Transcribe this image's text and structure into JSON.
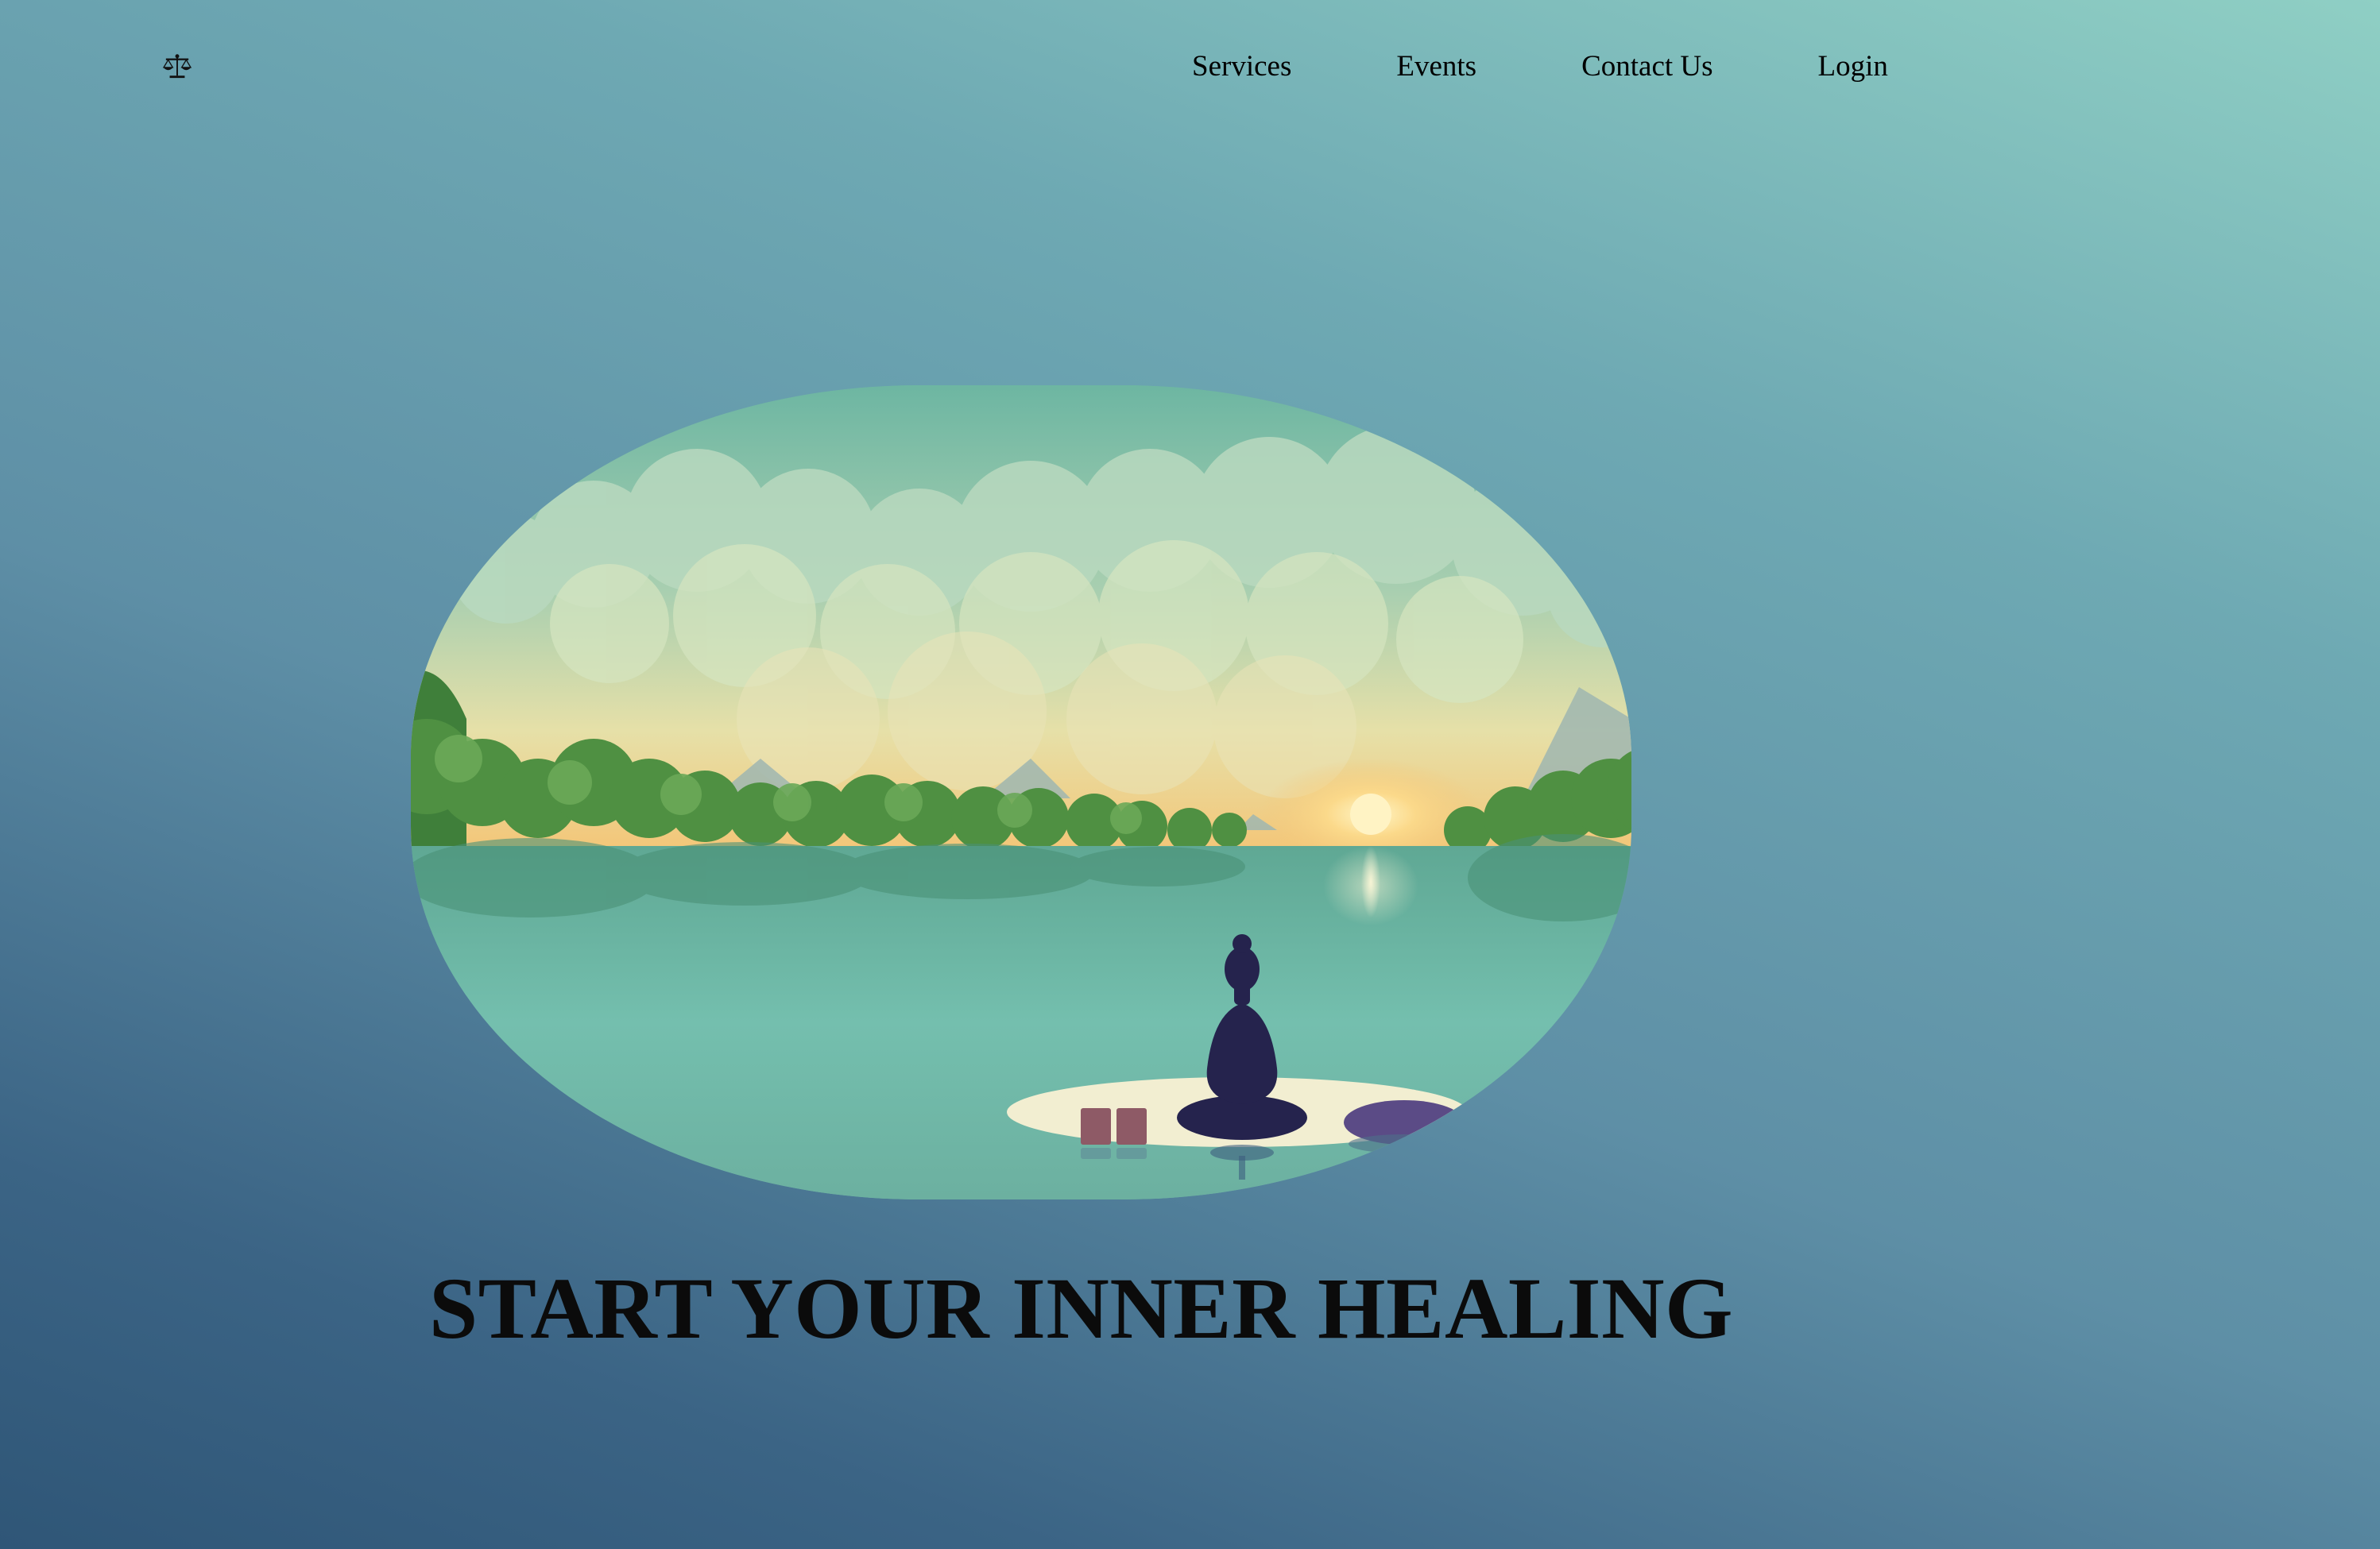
{
  "header": {
    "logo_icon": "balance-scale-icon",
    "nav": [
      {
        "label": "Services"
      },
      {
        "label": "Events"
      },
      {
        "label": "Contact Us"
      },
      {
        "label": "Login"
      }
    ]
  },
  "hero": {
    "image_description_icon": "meditation-lake-illustration",
    "title": "START YOUR INNER HEALING"
  },
  "colors": {
    "background_top": "#8fcfc4",
    "background_bottom": "#2f5677",
    "text": "#000000"
  }
}
